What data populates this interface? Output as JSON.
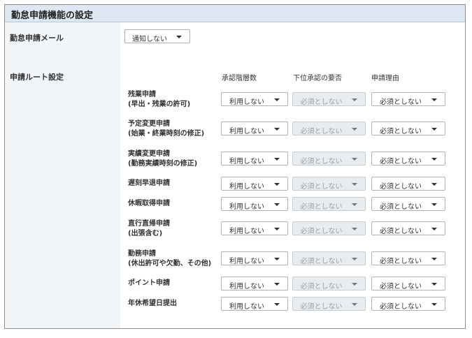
{
  "header": {
    "title": "勤怠申請機能の設定"
  },
  "mail": {
    "label": "勤怠申請メール",
    "value": "通知しない"
  },
  "route": {
    "label": "申請ルート設定",
    "columns": [
      "承認階層数",
      "下位承認の要否",
      "申請理由"
    ],
    "rows": [
      {
        "name": "残業申請",
        "sub": "(早出・残業の許可)",
        "levels": "利用しない",
        "lower": "必須としない",
        "reason": "必須としない"
      },
      {
        "name": "予定変更申請",
        "sub": "(始業・終業時刻の修正)",
        "levels": "利用しない",
        "lower": "必須としない",
        "reason": "必須としない"
      },
      {
        "name": "実績変更申請",
        "sub": "(勤務実績時刻の修正)",
        "levels": "利用しない",
        "lower": "必須としない",
        "reason": "必須としない"
      },
      {
        "name": "遅刻早退申請",
        "sub": "",
        "levels": "利用しない",
        "lower": "必須としない",
        "reason": "必須としない"
      },
      {
        "name": "休暇取得申請",
        "sub": "",
        "levels": "利用しない",
        "lower": "必須としない",
        "reason": "必須としない"
      },
      {
        "name": "直行直帰申請",
        "sub": "(出張含む)",
        "levels": "利用しない",
        "lower": "必須としない",
        "reason": "必須としない"
      },
      {
        "name": "勤務申請",
        "sub": "(休出許可や欠勤、その他)",
        "levels": "利用しない",
        "lower": "必須としない",
        "reason": "必須としない"
      },
      {
        "name": "ポイント申請",
        "sub": "",
        "levels": "利用しない",
        "lower": "必須としない",
        "reason": "必須としない"
      },
      {
        "name": "年休希望日提出",
        "sub": "",
        "levels": "利用しない",
        "lower": "必須としない",
        "reason": "必須としない"
      }
    ]
  }
}
